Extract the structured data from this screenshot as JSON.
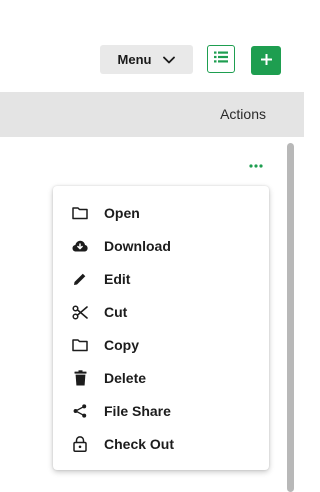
{
  "toolbar": {
    "menu_label": "Menu",
    "menu_icon": "chevron-down-icon",
    "list_view_icon": "list-view-icon",
    "add_icon": "plus-icon",
    "accent_color": "#1e9e50"
  },
  "table": {
    "actions_header": "Actions",
    "row_more_icon": "more-horizontal-icon"
  },
  "context_menu": {
    "items": [
      {
        "label": "Open",
        "icon": "folder-icon"
      },
      {
        "label": "Download",
        "icon": "cloud-download-icon"
      },
      {
        "label": "Edit",
        "icon": "pencil-icon"
      },
      {
        "label": "Cut",
        "icon": "scissors-icon"
      },
      {
        "label": "Copy",
        "icon": "folder-icon"
      },
      {
        "label": "Delete",
        "icon": "trash-icon"
      },
      {
        "label": "File Share",
        "icon": "share-icon"
      },
      {
        "label": "Check Out",
        "icon": "lock-icon"
      }
    ]
  }
}
